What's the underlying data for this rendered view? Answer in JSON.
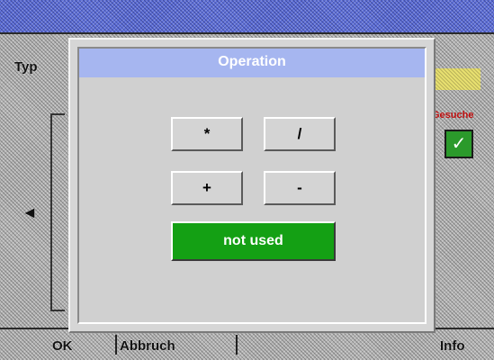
{
  "background": {
    "typ_label": "Typ",
    "back_arrow": "◄",
    "ok_label": "OK",
    "abbruch_label": "Abbruch",
    "info_label": "Info",
    "checkbox_glyph": "✓",
    "red_label": "Gesuche",
    "colors": {
      "titlebar": "#5d6fd8",
      "checkbox": "#2b9a2b",
      "swatch": "#e8e070"
    }
  },
  "dialog": {
    "title": "Operation",
    "buttons": {
      "multiply": "*",
      "divide": "/",
      "plus": "+",
      "minus": "-"
    },
    "selected_label": "not used",
    "colors": {
      "title_bar": "#a6b6f0",
      "selected": "#14a014"
    }
  }
}
